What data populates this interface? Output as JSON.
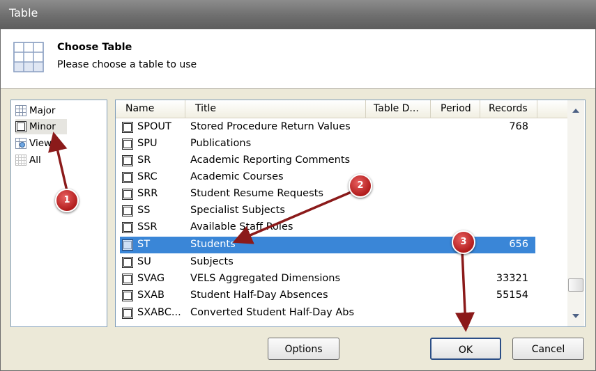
{
  "window": {
    "title": "Table"
  },
  "header": {
    "title": "Choose Table",
    "subtitle": "Please choose a table to use"
  },
  "left_panel": {
    "items": [
      {
        "label": "Major",
        "icon": "grid-icon"
      },
      {
        "label": "Minor",
        "icon": "grid-icon"
      },
      {
        "label": "Views",
        "icon": "view-icon"
      },
      {
        "label": "All",
        "icon": "grid-icon"
      }
    ]
  },
  "table_list": {
    "columns": [
      "Name",
      "Title",
      "Table D...",
      "Period",
      "Records"
    ],
    "rows": [
      {
        "name": "SPOUT",
        "title": "Stored Procedure Return Values",
        "records": "768"
      },
      {
        "name": "SPU",
        "title": "Publications",
        "records": ""
      },
      {
        "name": "SR",
        "title": "Academic Reporting Comments",
        "records": ""
      },
      {
        "name": "SRC",
        "title": "Academic Courses",
        "records": ""
      },
      {
        "name": "SRR",
        "title": "Student Resume Requests",
        "records": ""
      },
      {
        "name": "SS",
        "title": "Specialist Subjects",
        "records": ""
      },
      {
        "name": "SSR",
        "title": "Available Staff Roles",
        "records": ""
      },
      {
        "name": "ST",
        "title": "Students",
        "records": "656",
        "selected": true
      },
      {
        "name": "SU",
        "title": "Subjects",
        "records": ""
      },
      {
        "name": "SVAG",
        "title": "VELS Aggregated Dimensions",
        "records": "33321"
      },
      {
        "name": "SXAB",
        "title": "Student Half-Day Absences",
        "records": "55154"
      },
      {
        "name": "SXABC...",
        "title": "Converted Student Half-Day Abs",
        "records": ""
      }
    ]
  },
  "buttons": {
    "options": "Options",
    "ok": "OK",
    "cancel": "Cancel"
  },
  "annotations": [
    "1",
    "2",
    "3"
  ],
  "colors": {
    "selection": "#3a86d7",
    "badge": "#c02626",
    "arrow": "#8b1a1a"
  }
}
